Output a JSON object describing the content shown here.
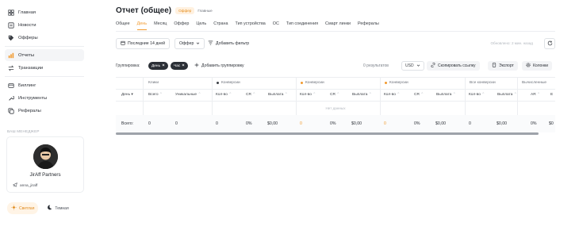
{
  "sidebar": {
    "items": [
      {
        "label": "Главная",
        "icon": "home-icon"
      },
      {
        "label": "Новости",
        "icon": "news-icon"
      },
      {
        "label": "Офферы",
        "icon": "tag-icon"
      },
      {
        "label": "Отчеты",
        "icon": "chart-icon",
        "active": true
      },
      {
        "label": "Транзакции",
        "icon": "transactions-icon"
      },
      {
        "label": "Биллинг",
        "icon": "billing-icon"
      },
      {
        "label": "Инструменты",
        "icon": "tools-icon"
      },
      {
        "label": "Рефералы",
        "icon": "referrals-icon"
      }
    ],
    "manager_title": "ВАШ МЕНЕДЖЕР",
    "manager_name": "JirAff Partners",
    "manager_link": "anna_jiraff",
    "theme_light": "Светлая",
    "theme_dark": "Темная"
  },
  "header": {
    "title": "Отчет (общее)",
    "badge_offers": "Оффер",
    "badge_main": "Главные"
  },
  "tabs": [
    "Общее",
    "День",
    "Месяц",
    "Оффер",
    "Цель",
    "Страна",
    "Тип устройства",
    "ОС",
    "Тип соединения",
    "Смарт линки",
    "Рефералы"
  ],
  "filters": {
    "period": "Последние 14 дней",
    "offer": "Оффер",
    "add_filter": "Добавить фильтр",
    "updated": "Обновлено: 2 мин. назад"
  },
  "grouping": {
    "label": "Группировка:",
    "chips": [
      "День",
      "Час"
    ],
    "add": "Добавить группировку",
    "results": "0 результатов",
    "currency": "USD",
    "copy_link": "Скопировать ссылку",
    "export": "Экспорт",
    "columns": "Колонки"
  },
  "table": {
    "groups": [
      {
        "label": "Клики"
      },
      {
        "label": "Конверсии",
        "color": "#3b3f45"
      },
      {
        "label": "Конверсии",
        "color": "#f29a2e"
      },
      {
        "label": "Конверсии",
        "color": "#f29a2e"
      },
      {
        "label": "Все конверсии"
      },
      {
        "label": "Вычисленные"
      }
    ],
    "columns": [
      "День",
      "Всего",
      "Уникальные",
      "Кол-во",
      "CR",
      "Выплата",
      "Кол-во",
      "CR",
      "Выплата",
      "Кол-во",
      "CR",
      "Выплата",
      "Кол-во",
      "Выплата",
      "AR",
      "E"
    ],
    "no_data": "Нет данных",
    "totals": [
      "Всего:",
      "0",
      "0",
      "0",
      "0%",
      "$0,00",
      "0",
      "0%",
      "$0,00",
      "0",
      "0%",
      "$0,00",
      "0",
      "$0,00",
      "0%",
      "$0"
    ]
  }
}
